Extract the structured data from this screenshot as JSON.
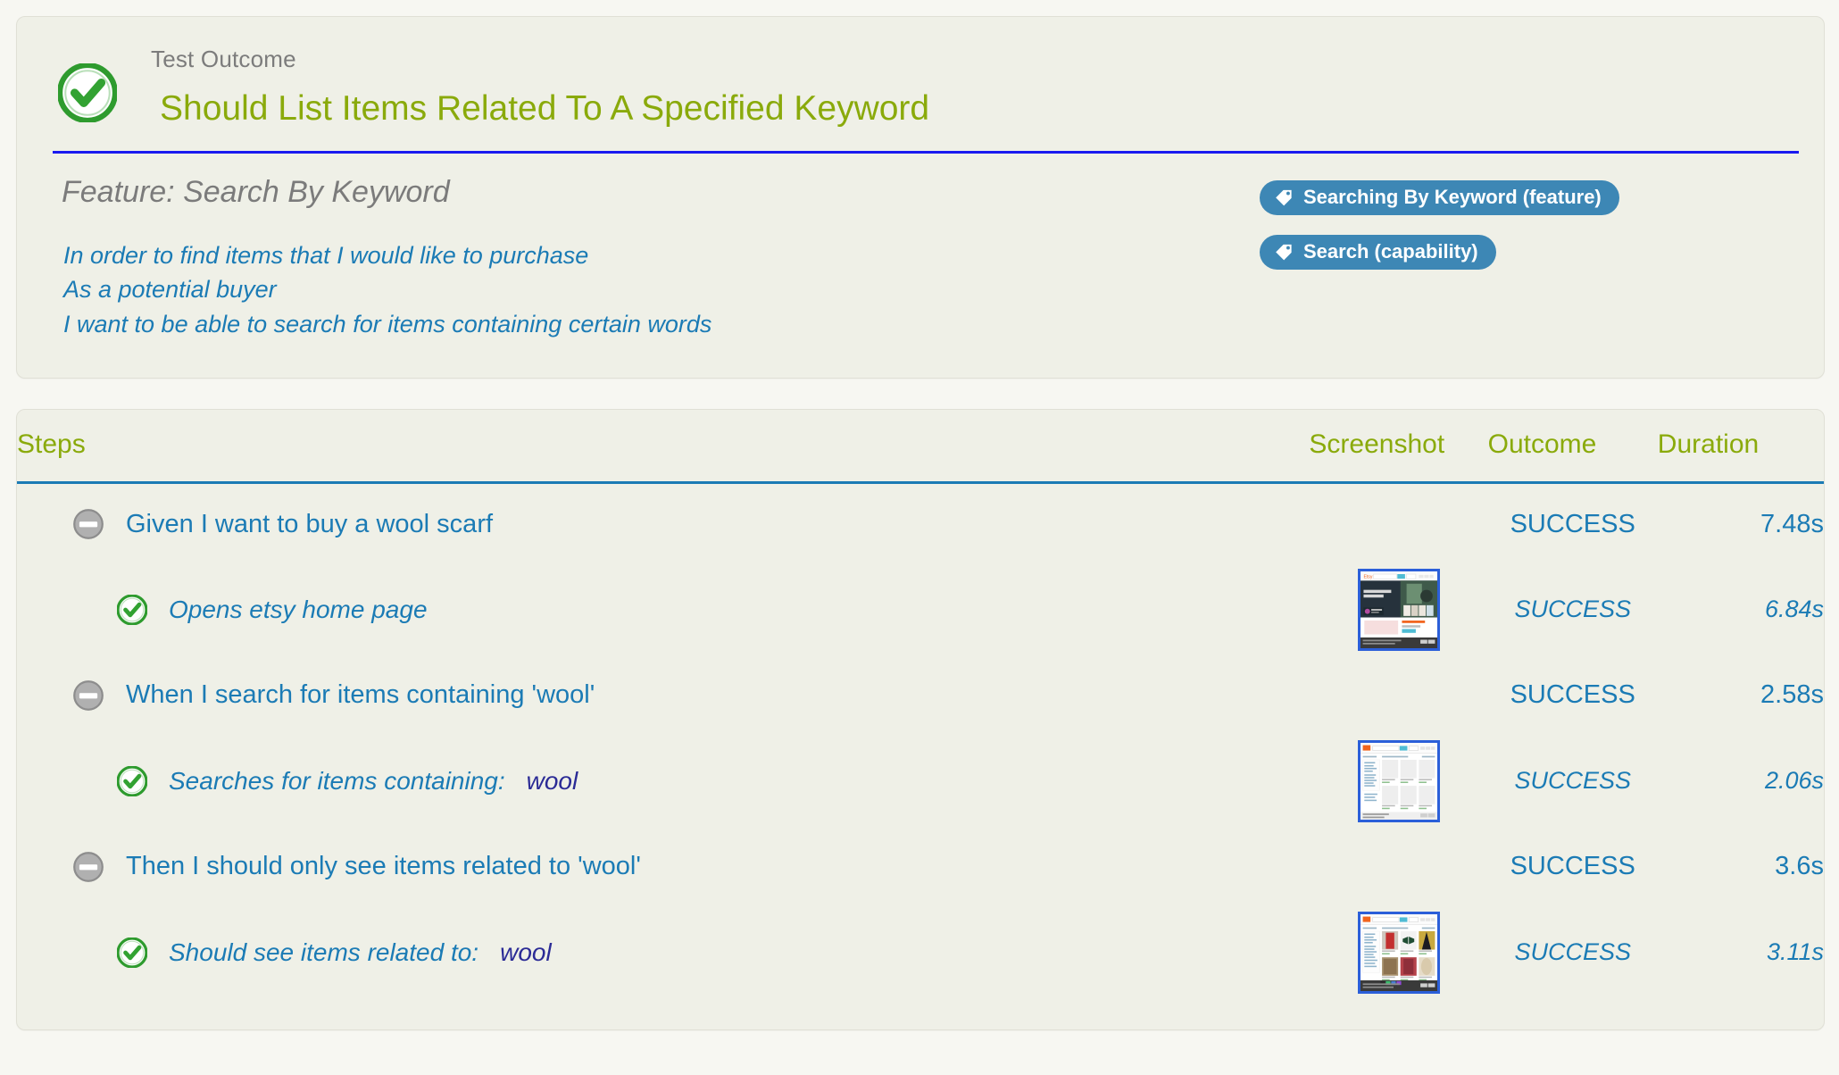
{
  "report": {
    "outcome_label": "Test Outcome",
    "title": "Should List Items Related To A Specified Keyword",
    "status_icon": "success-check-icon"
  },
  "feature": {
    "heading": "Feature: Search By Keyword",
    "narrative": [
      "In order to find items that I would like to purchase",
      "As a potential buyer",
      "I want to be able to search for items containing certain words"
    ]
  },
  "tags": [
    {
      "label": "Searching By Keyword (feature)",
      "icon": "tag-icon"
    },
    {
      "label": "Search (capability)",
      "icon": "tag-icon"
    }
  ],
  "steps_table": {
    "headers": {
      "steps": "Steps",
      "screenshot": "Screenshot",
      "outcome": "Outcome",
      "duration": "Duration"
    },
    "rows": [
      {
        "level": "parent",
        "icon": "collapse-minus-icon",
        "text": "Given I want to buy a wool scarf",
        "arg": "",
        "screenshot": "none",
        "outcome": "SUCCESS",
        "duration": "7.48s"
      },
      {
        "level": "child",
        "icon": "success-check-icon",
        "text": "Opens etsy home page",
        "arg": "",
        "screenshot": "etsy-home-page-thumbnail",
        "outcome": "SUCCESS",
        "duration": "6.84s"
      },
      {
        "level": "parent",
        "icon": "collapse-minus-icon",
        "text": "When I search for items containing 'wool'",
        "arg": "",
        "screenshot": "none",
        "outcome": "SUCCESS",
        "duration": "2.58s"
      },
      {
        "level": "child",
        "icon": "success-check-icon",
        "text": "Searches for items containing:",
        "arg": "wool",
        "screenshot": "search-results-blank-thumbnail",
        "outcome": "SUCCESS",
        "duration": "2.06s"
      },
      {
        "level": "parent",
        "icon": "collapse-minus-icon",
        "text": "Then I should only see items related to 'wool'",
        "arg": "",
        "screenshot": "none",
        "outcome": "SUCCESS",
        "duration": "3.6s"
      },
      {
        "level": "child",
        "icon": "success-check-icon",
        "text": "Should see items related to:",
        "arg": "wool",
        "screenshot": "search-results-products-thumbnail",
        "outcome": "SUCCESS",
        "duration": "3.11s"
      }
    ]
  },
  "colors": {
    "page_background": "#f7f7f2",
    "panel_background": "#eff0e7",
    "title_green": "#8aaa0b",
    "link_blue": "#1b7bb5",
    "rule_blue": "#1a1af0",
    "header_rule": "#1b7bb5",
    "tag_badge": "#3d87b5",
    "label_gray": "#7c7c7c",
    "arg_navy": "#2b2b96",
    "success_green": "#2e9b2e"
  }
}
